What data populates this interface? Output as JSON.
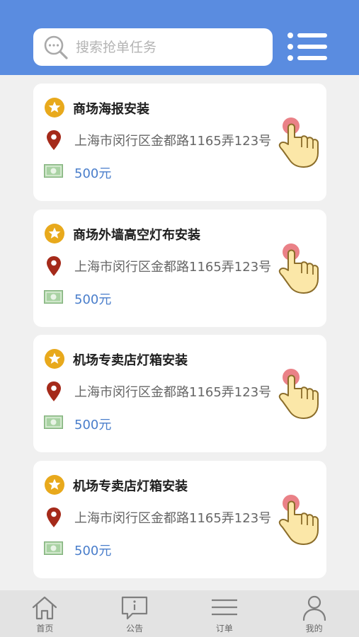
{
  "colors": {
    "header_blue": "#5a8ce0",
    "price_blue": "#4a7ecb",
    "star_gold": "#e8a91c",
    "pin_red": "#a52a1a",
    "money_green": "#8fbf8a",
    "hand_fill": "#fbe7a8",
    "finger_dot": "#e8737a"
  },
  "search": {
    "placeholder": "搜索抢单任务",
    "value": ""
  },
  "header": {
    "menu_icon": "list-menu-icon",
    "search_icon": "search-icon"
  },
  "tasks": [
    {
      "title": "商场海报安装",
      "address": "上海市闵行区金都路1165弄123号",
      "price": "500元"
    },
    {
      "title": "商场外墙高空灯布安装",
      "address": "上海市闵行区金都路1165弄123号",
      "price": "500元"
    },
    {
      "title": "机场专卖店灯箱安装",
      "address": "上海市闵行区金都路1165弄123号",
      "price": "500元"
    },
    {
      "title": "机场专卖店灯箱安装",
      "address": "上海市闵行区金都路1165弄123号",
      "price": "500元"
    }
  ],
  "tabbar": {
    "items": [
      {
        "label": "首页",
        "icon": "home-icon"
      },
      {
        "label": "公告",
        "icon": "announcement-icon"
      },
      {
        "label": "订单",
        "icon": "orders-icon"
      },
      {
        "label": "我的",
        "icon": "user-icon"
      }
    ]
  }
}
